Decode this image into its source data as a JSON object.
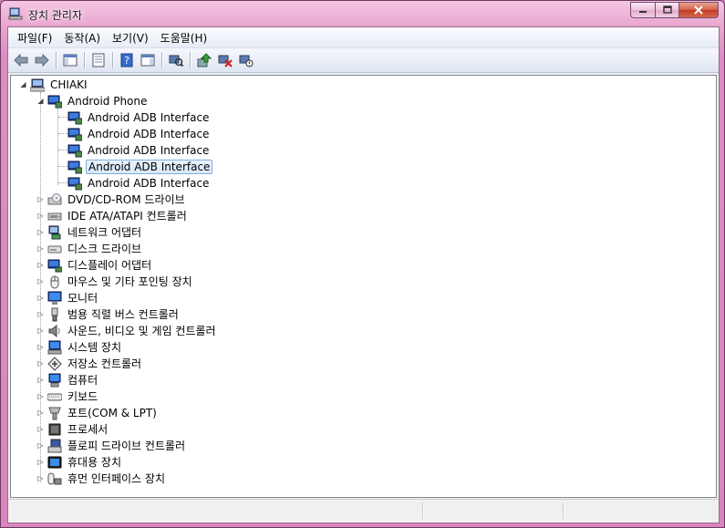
{
  "window": {
    "title": "장치 관리자",
    "title_icon": "device-manager-icon"
  },
  "menu": [
    {
      "label": "파일(F)"
    },
    {
      "label": "동작(A)"
    },
    {
      "label": "보기(V)"
    },
    {
      "label": "도움말(H)"
    }
  ],
  "toolbar": {
    "buttons": [
      "back-arrow-icon",
      "forward-arrow-icon",
      "show-hide-console-tree-icon",
      "properties-icon",
      "help-icon",
      "action-pane-icon",
      "scan-hardware-icon",
      "update-driver-icon",
      "uninstall-icon",
      "disable-device-icon"
    ]
  },
  "tree": {
    "root": {
      "label": "CHIAKI",
      "icon": "computer-icon"
    },
    "android": {
      "label": "Android Phone",
      "icon": "android-phone-icon",
      "children": [
        {
          "label": "Android ADB Interface"
        },
        {
          "label": "Android ADB Interface"
        },
        {
          "label": "Android ADB Interface"
        },
        {
          "label": "Android ADB Interface",
          "selected": true
        },
        {
          "label": "Android ADB Interface"
        }
      ]
    },
    "categories": [
      {
        "label": "DVD/CD-ROM 드라이브",
        "icon": "dvd-drive-icon"
      },
      {
        "label": "IDE ATA/ATAPI 컨트롤러",
        "icon": "ide-controller-icon"
      },
      {
        "label": "네트워크 어댑터",
        "icon": "network-adapter-icon"
      },
      {
        "label": "디스크 드라이브",
        "icon": "disk-drive-icon"
      },
      {
        "label": "디스플레이 어댑터",
        "icon": "display-adapter-icon"
      },
      {
        "label": "마우스 및 기타 포인팅 장치",
        "icon": "mouse-icon"
      },
      {
        "label": "모니터",
        "icon": "monitor-icon"
      },
      {
        "label": "범용 직렬 버스 컨트롤러",
        "icon": "usb-icon"
      },
      {
        "label": "사운드, 비디오 및 게임 컨트롤러",
        "icon": "speaker-icon"
      },
      {
        "label": "시스템 장치",
        "icon": "system-device-icon"
      },
      {
        "label": "저장소 컨트롤러",
        "icon": "storage-controller-icon"
      },
      {
        "label": "컴퓨터",
        "icon": "computer-icon"
      },
      {
        "label": "키보드",
        "icon": "keyboard-icon"
      },
      {
        "label": "포트(COM & LPT)",
        "icon": "port-icon"
      },
      {
        "label": "프로세서",
        "icon": "processor-icon"
      },
      {
        "label": "플로피 드라이브 컨트롤러",
        "icon": "floppy-controller-icon"
      },
      {
        "label": "휴대용 장치",
        "icon": "portable-device-icon"
      },
      {
        "label": "휴먼 인터페이스 장치",
        "icon": "hid-icon"
      }
    ]
  },
  "colors": {
    "frame": "#e9a6d0",
    "selection": "#d7e8fb",
    "close_button": "#c23a22"
  }
}
